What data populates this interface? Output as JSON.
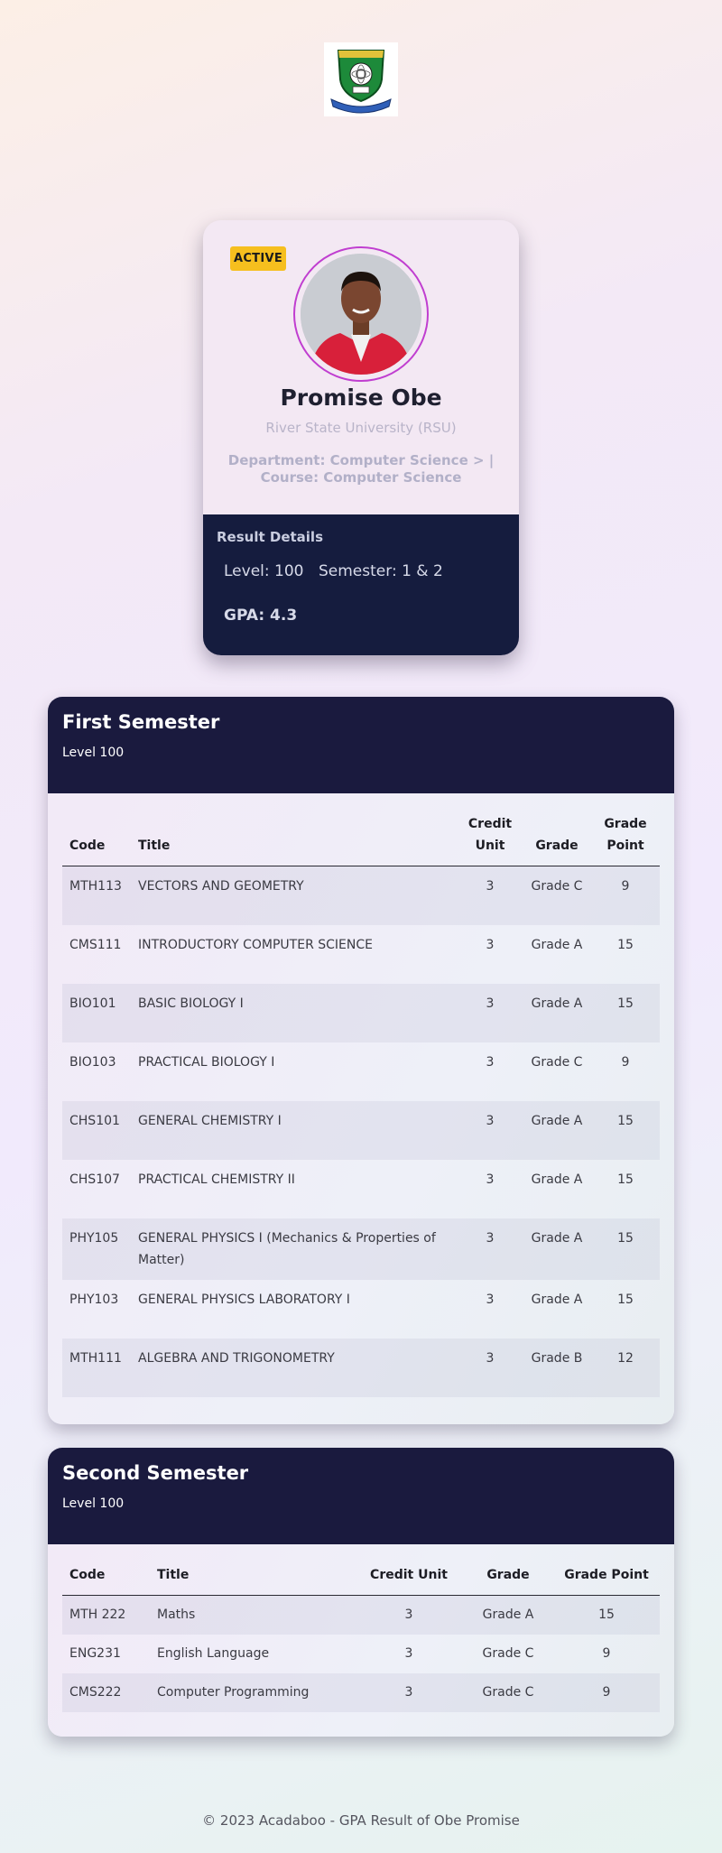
{
  "profile": {
    "status_badge": "ACTIVE",
    "name": "Promise Obe",
    "university": "River State University (RSU)",
    "department_course": "Department: Computer Science > | Course: Computer Science"
  },
  "result_details": {
    "title": "Result Details",
    "level": "Level: 100",
    "semester": "Semester: 1 & 2",
    "gpa": "GPA: 4.3"
  },
  "first_semester": {
    "title": "First Semester",
    "level": "Level 100",
    "headers": {
      "code": "Code",
      "title": "Title",
      "credit_unit": "Credit Unit",
      "grade": "Grade",
      "grade_point": "Grade Point"
    },
    "rows": [
      {
        "code": "MTH113",
        "title": "VECTORS AND GEOMETRY",
        "credit_unit": "3",
        "grade": "Grade C",
        "grade_point": "9"
      },
      {
        "code": "CMS111",
        "title": "INTRODUCTORY COMPUTER SCIENCE",
        "credit_unit": "3",
        "grade": "Grade A",
        "grade_point": "15"
      },
      {
        "code": "BIO101",
        "title": "BASIC BIOLOGY I",
        "credit_unit": "3",
        "grade": "Grade A",
        "grade_point": "15"
      },
      {
        "code": "BIO103",
        "title": "PRACTICAL BIOLOGY I",
        "credit_unit": "3",
        "grade": "Grade C",
        "grade_point": "9"
      },
      {
        "code": "CHS101",
        "title": "GENERAL CHEMISTRY I",
        "credit_unit": "3",
        "grade": "Grade A",
        "grade_point": "15"
      },
      {
        "code": "CHS107",
        "title": "PRACTICAL CHEMISTRY II",
        "credit_unit": "3",
        "grade": "Grade A",
        "grade_point": "15"
      },
      {
        "code": "PHY105",
        "title": "GENERAL PHYSICS I (Mechanics & Properties of Matter)",
        "credit_unit": "3",
        "grade": "Grade A",
        "grade_point": "15"
      },
      {
        "code": "PHY103",
        "title": "GENERAL PHYSICS LABORATORY I",
        "credit_unit": "3",
        "grade": "Grade A",
        "grade_point": "15"
      },
      {
        "code": "MTH111",
        "title": "ALGEBRA AND TRIGONOMETRY",
        "credit_unit": "3",
        "grade": "Grade B",
        "grade_point": "12"
      }
    ]
  },
  "second_semester": {
    "title": "Second Semester",
    "level": "Level 100",
    "headers": {
      "code": "Code",
      "title": "Title",
      "credit_unit": "Credit Unit",
      "grade": "Grade",
      "grade_point": "Grade Point"
    },
    "rows": [
      {
        "code": "MTH 222",
        "title": "Maths",
        "credit_unit": "3",
        "grade": "Grade A",
        "grade_point": "15"
      },
      {
        "code": "ENG231",
        "title": "English Language",
        "credit_unit": "3",
        "grade": "Grade C",
        "grade_point": "9"
      },
      {
        "code": "CMS222",
        "title": "Computer Programming",
        "credit_unit": "3",
        "grade": "Grade C",
        "grade_point": "9"
      }
    ]
  },
  "footer": "© 2023 Acadaboo - GPA Result of Obe Promise",
  "icons": {
    "logo": "university-crest-icon",
    "avatar": "student-photo"
  },
  "colors": {
    "dark_panel": "#151c3e",
    "badge": "#f6bf1e",
    "avatar_ring": "#c03ed0"
  }
}
